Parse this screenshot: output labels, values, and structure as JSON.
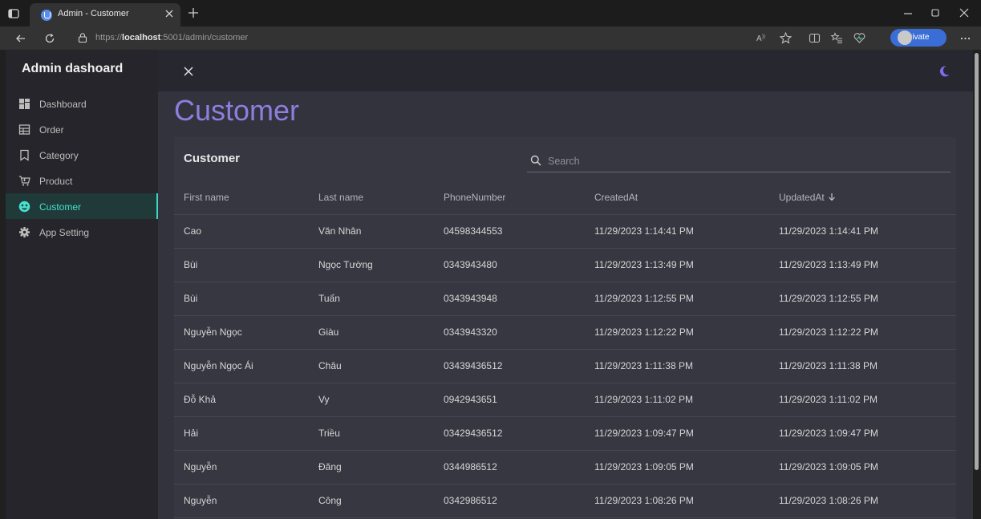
{
  "browser": {
    "tab_title": "Admin - Customer",
    "url_prefix": "https://",
    "url_host": "localhost",
    "url_rest": ":5001/admin/customer",
    "inprivate_label": "InPrivate"
  },
  "sidebar": {
    "brand": "Admin dashoard",
    "items": [
      {
        "label": "Dashboard",
        "icon": "dashboard-icon"
      },
      {
        "label": "Order",
        "icon": "order-icon"
      },
      {
        "label": "Category",
        "icon": "bookmark-icon"
      },
      {
        "label": "Product",
        "icon": "cart-icon"
      },
      {
        "label": "Customer",
        "icon": "customer-icon",
        "active": true
      },
      {
        "label": "App Setting",
        "icon": "gear-icon"
      }
    ]
  },
  "page": {
    "title": "Customer"
  },
  "card": {
    "title": "Customer",
    "search_placeholder": "Search"
  },
  "table": {
    "columns": [
      "First name",
      "Last name",
      "PhoneNumber",
      "CreatedAt",
      "UpdatedAt"
    ],
    "sorted_column": "UpdatedAt",
    "sort_direction": "descending",
    "rows": [
      [
        "Cao",
        "Văn Nhân",
        "04598344553",
        "11/29/2023 1:14:41 PM",
        "11/29/2023 1:14:41 PM"
      ],
      [
        "Bùi",
        "Ngọc Tường",
        "0343943480",
        "11/29/2023 1:13:49 PM",
        "11/29/2023 1:13:49 PM"
      ],
      [
        "Bùi",
        "Tuấn",
        "0343943948",
        "11/29/2023 1:12:55 PM",
        "11/29/2023 1:12:55 PM"
      ],
      [
        "Nguyễn Ngọc",
        "Giàu",
        "0343943320",
        "11/29/2023 1:12:22 PM",
        "11/29/2023 1:12:22 PM"
      ],
      [
        "Nguyễn Ngọc Ái",
        "Châu",
        "03439436512",
        "11/29/2023 1:11:38 PM",
        "11/29/2023 1:11:38 PM"
      ],
      [
        "Đỗ Khả",
        "Vy",
        "0942943651",
        "11/29/2023 1:11:02 PM",
        "11/29/2023 1:11:02 PM"
      ],
      [
        "Hải",
        "Triều",
        "03429436512",
        "11/29/2023 1:09:47 PM",
        "11/29/2023 1:09:47 PM"
      ],
      [
        "Nguyễn",
        "Đăng",
        "0344986512",
        "11/29/2023 1:09:05 PM",
        "11/29/2023 1:09:05 PM"
      ],
      [
        "Nguyễn",
        "Công",
        "0342986512",
        "11/29/2023 1:08:26 PM",
        "11/29/2023 1:08:26 PM"
      ]
    ]
  },
  "colors": {
    "accent_purple": "#8f7ddf",
    "accent_teal": "#46e0cd",
    "sidebar_bg": "#25252b",
    "content_bg": "#32333d",
    "card_bg": "#373741"
  }
}
